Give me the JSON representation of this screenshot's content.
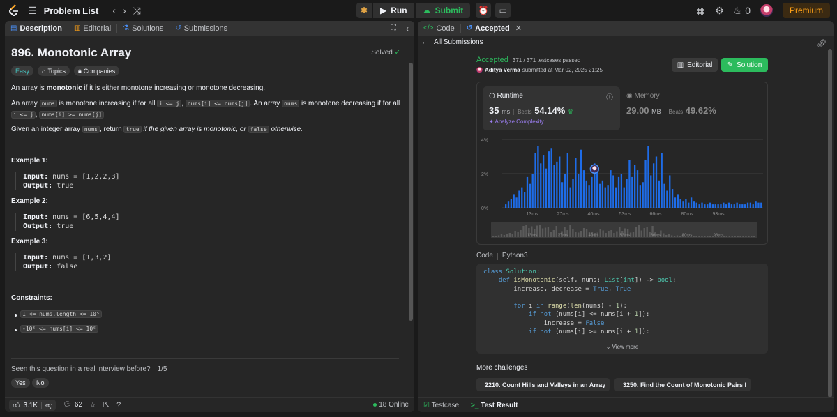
{
  "nav": {
    "title": "Problem List",
    "run_label": "Run",
    "submit_label": "Submit",
    "coins": "0",
    "premium_label": "Premium"
  },
  "left_tabs": [
    "Description",
    "Editorial",
    "Solutions",
    "Submissions"
  ],
  "problem": {
    "title": "896. Monotonic Array",
    "solved_label": "Solved",
    "difficulty": "Easy",
    "topics_label": "Topics",
    "companies_label": "Companies",
    "p1_pre": "An array is ",
    "p1_bold": "monotonic",
    "p1_post": " if it is either monotone increasing or monotone decreasing.",
    "p2_a": "An array ",
    "p2_b": " is monotone increasing if for all ",
    "p2_c": ", ",
    "p2_d": ". An array ",
    "p2_e": " is monotone decreasing if for all ",
    "p2_f": ", ",
    "p2_g": ".",
    "code_nums": "nums",
    "code_ilej": "i <= j",
    "code_inc": "nums[i] <= nums[j]",
    "code_dec": "nums[i] >= nums[j]",
    "p3_a": "Given an integer array ",
    "p3_b": ", return ",
    "p3_c": " if the given array is monotonic, or ",
    "p3_d": " otherwise.",
    "code_true": "true",
    "code_false": "false",
    "examples": [
      {
        "title": "Example 1:",
        "input": "nums = [1,2,2,3]",
        "output": "true"
      },
      {
        "title": "Example 2:",
        "input": "nums = [6,5,4,4]",
        "output": "true"
      },
      {
        "title": "Example 3:",
        "input": "nums = [1,3,2]",
        "output": "false"
      }
    ],
    "input_label": "Input:",
    "output_label": "Output:",
    "constraints_title": "Constraints:",
    "constraint1": "1 <= nums.length <= 10⁵",
    "constraint2": "-10⁵ <= nums[i] <= 10⁵",
    "interview_q": "Seen this question in a real interview before?",
    "interview_count": "1/5",
    "yes": "Yes",
    "no": "No"
  },
  "left_bottom": {
    "likes": "3.1K",
    "comments": "62",
    "online": "18 Online"
  },
  "right_tabs": {
    "code": "Code",
    "accepted": "Accepted"
  },
  "submission": {
    "all_label": "All Submissions",
    "status": "Accepted",
    "testcases": "371 / 371 testcases passed",
    "author": "Aditya Verma",
    "submitted_at": "submitted at Mar 02, 2025 21:25",
    "editorial_label": "Editorial",
    "solution_label": "Solution",
    "runtime_label": "Runtime",
    "runtime_value": "35",
    "runtime_unit": "ms",
    "beats_label": "Beats",
    "runtime_beats": "54.14%",
    "analyze_label": "Analyze Complexity",
    "memory_label": "Memory",
    "memory_value": "29.00",
    "memory_unit": "MB",
    "memory_beats": "49.62%"
  },
  "code_section": {
    "label": "Code",
    "lang": "Python3",
    "view_more": "View more"
  },
  "more_challenges": {
    "label": "More challenges",
    "items": [
      {
        "title": "2210. Count Hills and Valleys in an Array",
        "color": "#46c6c2"
      },
      {
        "title": "3250. Find the Count of Monotonic Pairs I",
        "color": "#f63737"
      }
    ]
  },
  "right_bottom": {
    "testcase": "Testcase",
    "test_result": "Test Result"
  },
  "chart_data": {
    "type": "bar",
    "title": "",
    "ylabel": "",
    "xlabel": "",
    "y_ticks": [
      "4%",
      "2%",
      "0%"
    ],
    "x_ticks": [
      "13ms",
      "27ms",
      "40ms",
      "53ms",
      "66ms",
      "80ms",
      "93ms"
    ],
    "ylim": [
      0,
      4
    ],
    "values": [
      0.2,
      0.4,
      0.5,
      0.8,
      0.6,
      1.0,
      1.2,
      0.9,
      1.8,
      1.4,
      2.0,
      3.2,
      3.6,
      2.6,
      3.1,
      2.3,
      3.3,
      3.5,
      2.5,
      2.7,
      3.0,
      1.5,
      2.0,
      3.2,
      1.2,
      1.7,
      2.9,
      2.0,
      3.4,
      2.2,
      1.6,
      1.3,
      1.8,
      2.6,
      2.3,
      1.4,
      1.6,
      1.2,
      1.3,
      2.2,
      1.9,
      1.2,
      1.8,
      2.0,
      1.2,
      1.7,
      2.8,
      1.8,
      2.5,
      2.2,
      1.3,
      1.5,
      2.8,
      3.6,
      1.9,
      2.6,
      3.0,
      1.6,
      3.2,
      1.4,
      1.0,
      1.9,
      1.1,
      0.6,
      0.8,
      0.5,
      0.4,
      0.5,
      0.3,
      0.6,
      0.4,
      0.3,
      0.2,
      0.3,
      0.2,
      0.2,
      0.3,
      0.2,
      0.2,
      0.2,
      0.2,
      0.3,
      0.2,
      0.3,
      0.2,
      0.2,
      0.3,
      0.2,
      0.2,
      0.2,
      0.3,
      0.3,
      0.2,
      0.4,
      0.3,
      0.3
    ],
    "highlight_index": 33,
    "bar_color": "#1e6ce8",
    "grid": true
  }
}
